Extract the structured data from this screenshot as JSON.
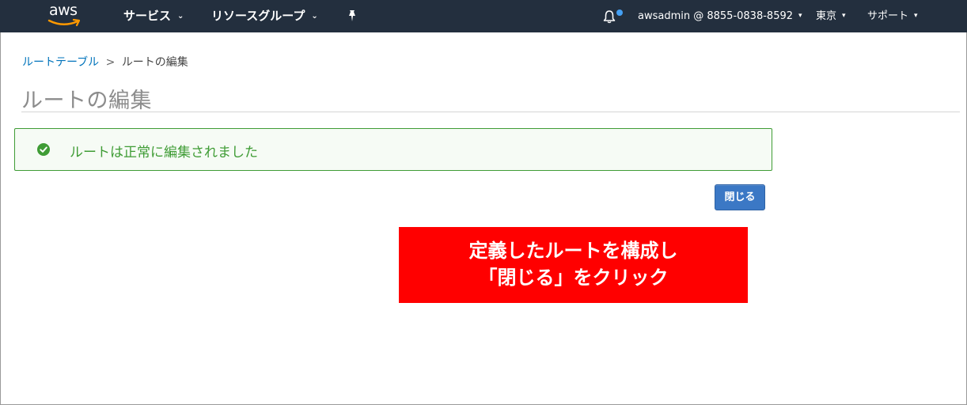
{
  "navbar": {
    "logo_text": "aws",
    "services_label": "サービス",
    "resource_groups_label": "リソースグループ",
    "account_label": "awsadmin @ 8855-0838-8592",
    "region_label": "東京",
    "support_label": "サポート",
    "icons": [
      "aws-logo",
      "chevron-down-icon",
      "pin-icon",
      "bell-icon"
    ],
    "colors": {
      "background": "#232f3e",
      "notification_dot": "#44a0f4"
    }
  },
  "breadcrumb": {
    "link_label": "ルートテーブル",
    "separator": ">",
    "current_label": "ルートの編集"
  },
  "page": {
    "title": "ルートの編集"
  },
  "alert": {
    "type": "success",
    "icon": "check-circle-icon",
    "message": "ルートは正常に編集されました",
    "colors": {
      "border": "#3f9c35",
      "text": "#3f9c35"
    }
  },
  "actions": {
    "close_label": "閉じる",
    "close_color": "#3b78c5"
  },
  "annotation": {
    "line1": "定義したルートを構成し",
    "line2": "「閉じる」をクリック",
    "background": "#ff0000"
  }
}
